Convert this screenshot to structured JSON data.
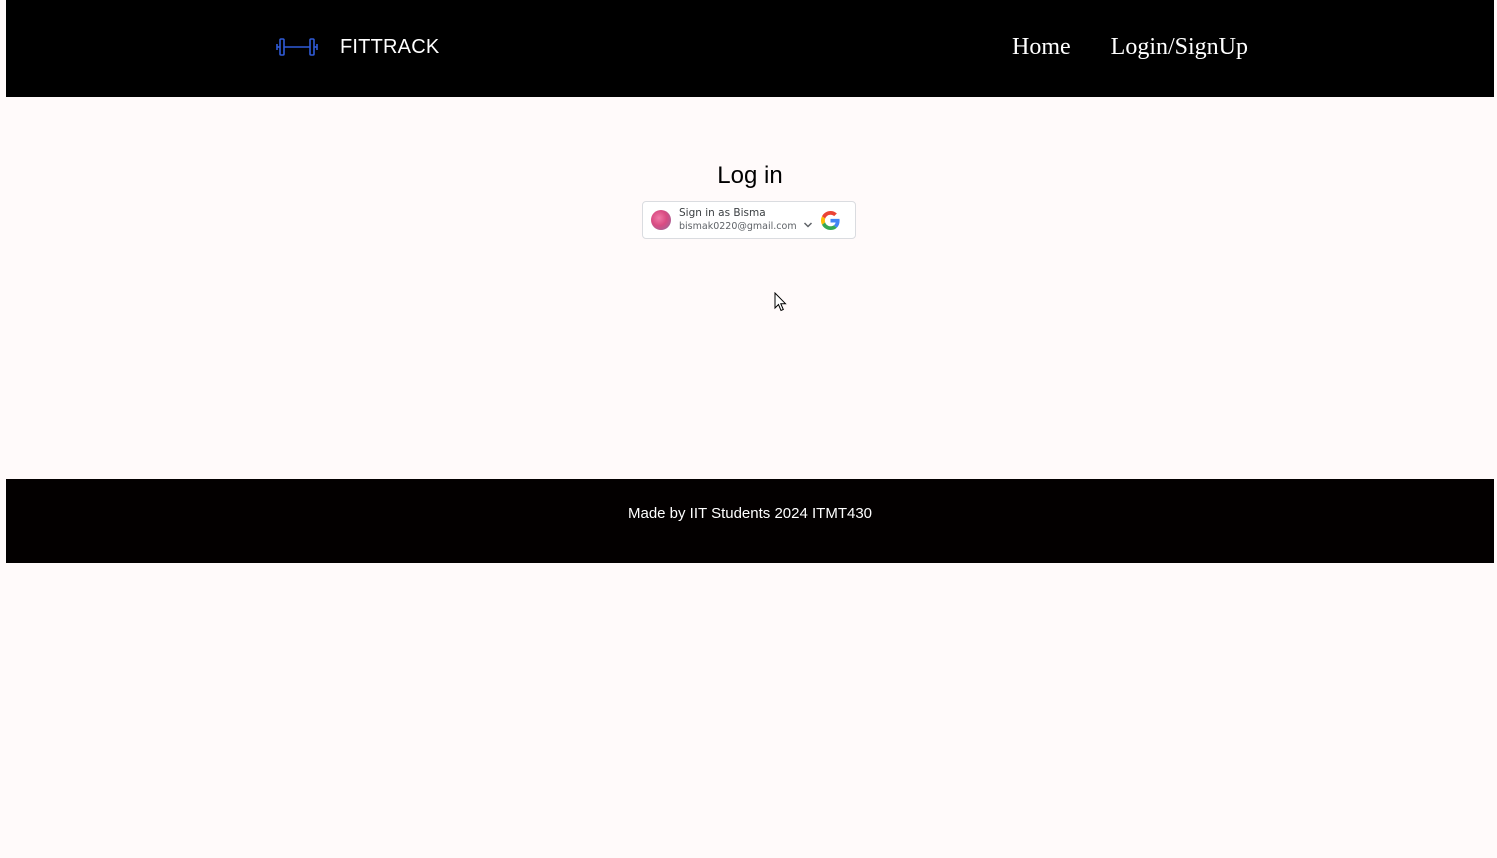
{
  "navbar": {
    "brand_icon": "dumbbell-icon",
    "brand_name": "FITTRACK",
    "links": [
      {
        "label": "Home"
      },
      {
        "label": "Login/SignUp"
      }
    ]
  },
  "login": {
    "title": "Log in",
    "google_button": {
      "name_line": "Sign in as Bisma",
      "email": "bismak0220@gmail.com",
      "chevron_icon": "chevron-down-icon",
      "logo_icon": "google-g-icon"
    }
  },
  "footer": {
    "text": "Made by IIT Students 2024 ITMT430"
  },
  "colors": {
    "navbar_bg": "#000000",
    "page_bg": "#fffafa",
    "brand_icon": "#2f5bd8",
    "footer_bg": "#030000"
  }
}
